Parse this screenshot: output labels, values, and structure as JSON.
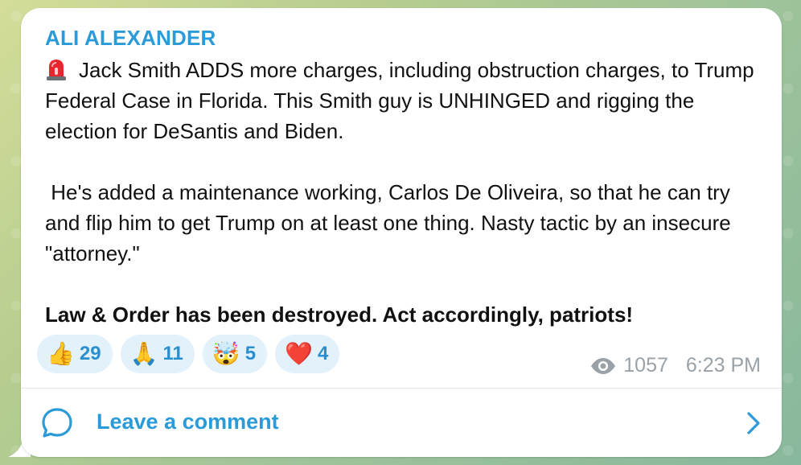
{
  "message": {
    "sender": "ALI ALEXANDER",
    "paragraph1": "Jack Smith ADDS more charges, including obstruction charges, to Trump Federal Case in Florida. This Smith guy is UNHINGED and rigging the election for DeSantis and Biden.",
    "paragraph2": " He's added a maintenance working, Carlos De Oliveira, so that he can try and flip him to get Trump on at least one thing. Nasty tactic by an insecure \"attorney.\"",
    "paragraph3": "Law & Order has been destroyed. Act accordingly, patriots!",
    "leading_icon": "rotating-light-siren-icon"
  },
  "reactions": [
    {
      "emoji": "👍",
      "icon": "thumbs-up-icon",
      "count": "29"
    },
    {
      "emoji": "🙏",
      "icon": "folded-hands-icon",
      "count": "11"
    },
    {
      "emoji": "🤯",
      "icon": "exploding-head-icon",
      "count": "5"
    },
    {
      "emoji": "❤️",
      "icon": "red-heart-icon",
      "count": "4"
    }
  ],
  "meta": {
    "views": "1057",
    "time": "6:23 PM",
    "views_icon": "eye-icon"
  },
  "comment": {
    "label": "Leave a comment",
    "icon": "comment-bubble-icon",
    "chevron": "chevron-right-icon"
  },
  "colors": {
    "accent": "#2a9bd8",
    "reaction_bg": "#e3f1fb",
    "meta_gray": "#9aa2a8",
    "text": "#111111",
    "bubble_bg": "#ffffff"
  }
}
